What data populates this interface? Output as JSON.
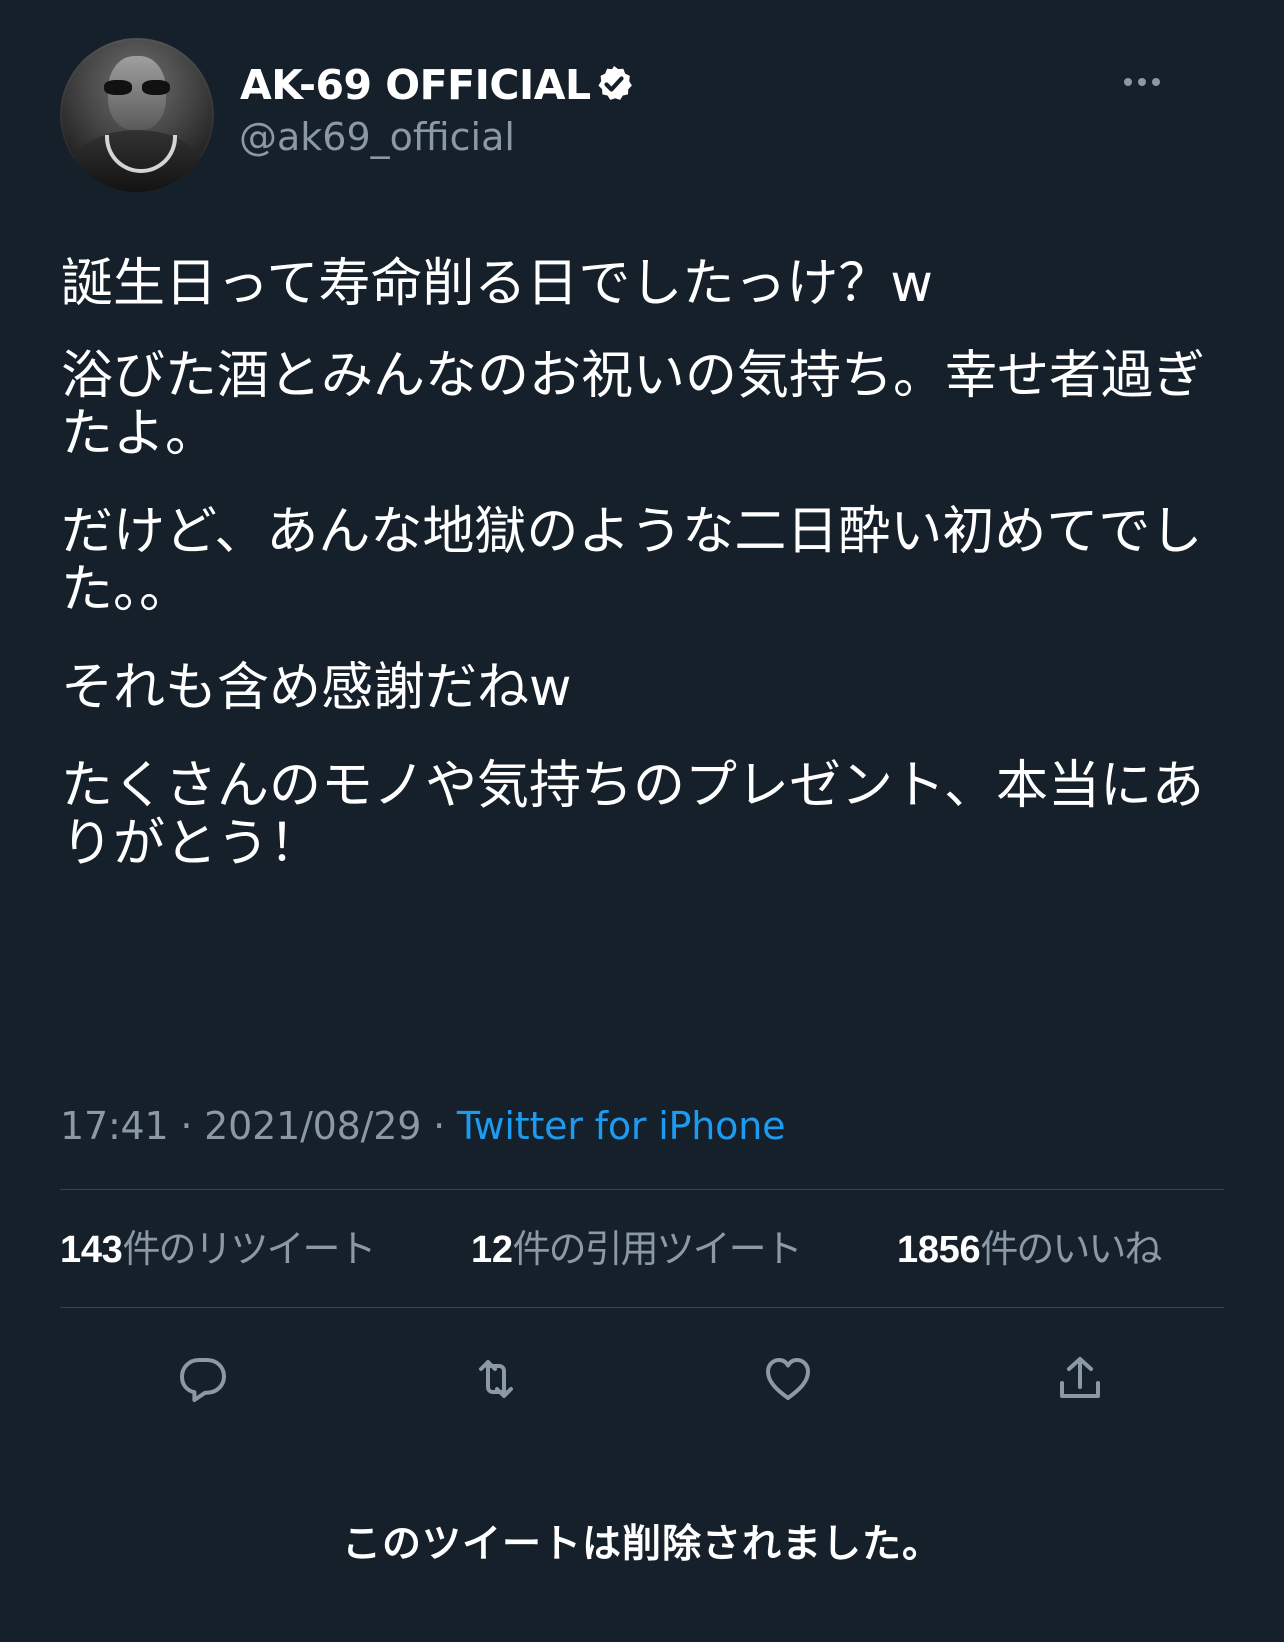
{
  "profile": {
    "display_name": "AK-69 OFFICIAL",
    "handle": "@ak69_official",
    "verified": true
  },
  "tweet": {
    "paragraphs": [
      "誕生日って寿命削る日でしたっけ？w",
      "浴びた酒とみんなのお祝いの気持ち。幸せ者過ぎたよ。",
      "だけど、あんな地獄のような二日酔い初めてでした。。",
      "それも含め感謝だねw",
      "たくさんのモノや気持ちのプレゼント、本当にありがとう！"
    ],
    "time": "17:41",
    "separator": " · ",
    "date": "2021/08/29",
    "source": "Twitter for iPhone"
  },
  "stats": {
    "retweets_count": "143",
    "retweets_label": "件のリツイート",
    "quotes_count": "12",
    "quotes_label": "件の引用ツイート",
    "likes_count": "1856",
    "likes_label": "件のいいね"
  },
  "status_message": "このツイートは削除されました。",
  "icons": {
    "more": "more-horizontal-icon",
    "verified": "verified-badge-icon",
    "reply": "reply-icon",
    "retweet": "retweet-icon",
    "like": "heart-icon",
    "share": "share-icon"
  },
  "colors": {
    "background": "#15202b",
    "text": "#ffffff",
    "secondary_text": "#8b98a5",
    "link": "#1d9bf0",
    "divider": "#38444d"
  }
}
